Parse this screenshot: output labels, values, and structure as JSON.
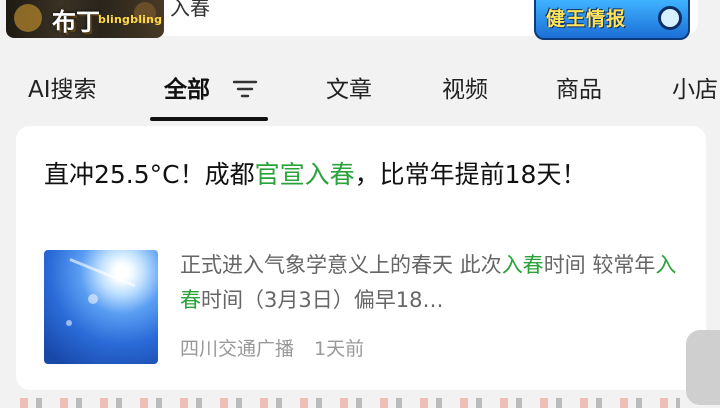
{
  "header": {
    "logo_sticker_text": "布丁",
    "logo_sticker_subtext": "blingbling",
    "query_fragment": "入春",
    "badge_sticker_text": "健王情报"
  },
  "tabs": [
    {
      "label": "AI搜索",
      "active": false
    },
    {
      "label": "全部",
      "active": true
    },
    {
      "label": "文章",
      "active": false
    },
    {
      "label": "视频",
      "active": false
    },
    {
      "label": "商品",
      "active": false
    },
    {
      "label": "小店",
      "active": false
    }
  ],
  "result": {
    "title_parts": [
      "直冲25.5°C！成都",
      "官宣入春",
      "，比常年提前18天！"
    ],
    "summary_parts": [
      "正式进入气象学意义上的春天 此次",
      "入春",
      "时间 较常年",
      "入春",
      "时间（3月3日）偏早18…"
    ],
    "source": "四川交通广播",
    "time": "1天前"
  },
  "colors": {
    "highlight": "#2aa33a",
    "page_bg": "#f2f2f2",
    "card_bg": "#ffffff"
  },
  "icons": {
    "filter": "filter-lines-icon",
    "search": "magnifier-icon"
  }
}
